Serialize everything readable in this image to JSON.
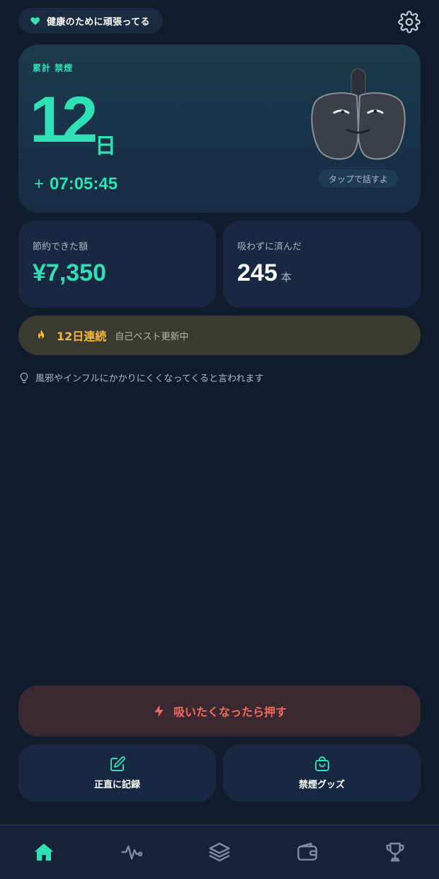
{
  "header": {
    "status_label": "健康のために頑張ってる",
    "settings_icon": "gear-icon"
  },
  "hero": {
    "caption": "累計 禁煙",
    "days_value": "12",
    "days_unit": "日",
    "elapsed_prefix": "+",
    "elapsed_time": "07:05:45",
    "tap_hint": "タップで話すよ"
  },
  "stats": {
    "saved_label": "節約できた額",
    "saved_value": "¥7,350",
    "avoided_label": "吸わずに済んだ",
    "avoided_value": "245",
    "avoided_unit": "本"
  },
  "streak": {
    "value": "12日連続",
    "note": "自己ベスト更新中"
  },
  "tip": {
    "text": "風邪やインフルにかかりにくくなってくると言われます"
  },
  "actions": {
    "craving_label": "吸いたくなったら押す",
    "record_label": "正直に記録",
    "goods_label": "禁煙グッズ"
  },
  "nav": {
    "items": [
      {
        "icon": "home-icon",
        "active": true
      },
      {
        "icon": "activity-icon",
        "active": false
      },
      {
        "icon": "layers-icon",
        "active": false
      },
      {
        "icon": "wallet-icon",
        "active": false
      },
      {
        "icon": "trophy-icon",
        "active": false
      }
    ]
  },
  "colors": {
    "accent": "#2fe0b4",
    "background": "#101c2c",
    "card": "#172840",
    "streak_text": "#f6b93a",
    "craving_text": "#f26b5e"
  }
}
